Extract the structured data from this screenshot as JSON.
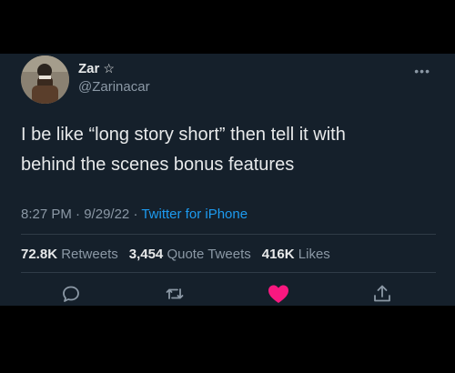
{
  "author": {
    "name": "Zar",
    "badge": "☆",
    "handle": "@Zarinacar"
  },
  "more_label": "•••",
  "tweet": {
    "text_line1": "I be like “long story short” then tell it with",
    "text_line2": "behind the scenes bonus features"
  },
  "meta": {
    "time": "8:27 PM",
    "date": "9/29/22",
    "sep": "·",
    "source": "Twitter for iPhone"
  },
  "stats": {
    "retweets_count": "72.8K",
    "retweets_label": "Retweets",
    "quotes_count": "3,454",
    "quotes_label": "Quote Tweets",
    "likes_count": "416K",
    "likes_label": "Likes"
  },
  "colors": {
    "background": "#15202b",
    "link": "#1d9bf0",
    "like": "#f91880",
    "muted": "#8b98a5"
  },
  "icons": {
    "reply": "reply-icon",
    "retweet": "retweet-icon",
    "like": "heart-icon",
    "share": "share-icon"
  }
}
